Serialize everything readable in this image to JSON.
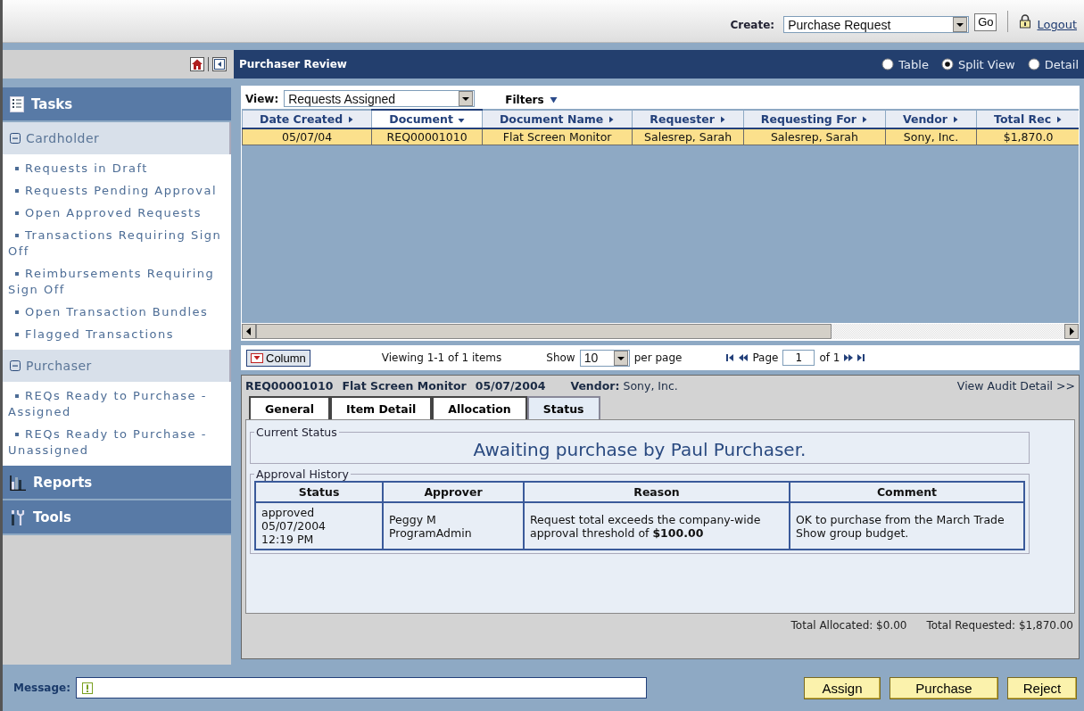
{
  "header": {
    "create_label": "Create:",
    "create_value": "Purchase Request",
    "go": "Go",
    "logout": "Logout"
  },
  "sidebar": {
    "sections": [
      {
        "title": "Tasks",
        "kind": "tasks",
        "groups": [
          {
            "title": "Cardholder",
            "expanded": true,
            "items": [
              "Requests in Draft",
              "Requests Pending Approval",
              "Open Approved Requests",
              "Transactions Requiring Sign Off",
              "Reimbursements Requiring Sign Off",
              "Open Transaction Bundles",
              "Flagged Transactions"
            ]
          },
          {
            "title": "Purchaser",
            "expanded": true,
            "items": [
              "REQs Ready to Purchase - Assigned",
              "REQs Ready to Purchase - Unassigned"
            ]
          }
        ]
      },
      {
        "title": "Reports",
        "kind": "reports"
      },
      {
        "title": "Tools",
        "kind": "tools"
      }
    ]
  },
  "main": {
    "title": "Purchaser Review",
    "view_modes": [
      {
        "label": "Table",
        "selected": false
      },
      {
        "label": "Split View",
        "selected": true
      },
      {
        "label": "Detail",
        "selected": false
      }
    ],
    "view_label": "View:",
    "view_value": "Requests Assigned",
    "filters": "Filters",
    "table": {
      "columns": [
        {
          "label": "Date Created",
          "sorted": false
        },
        {
          "label": "Document",
          "sorted": true
        },
        {
          "label": "Document Name",
          "sorted": false
        },
        {
          "label": "Requester",
          "sorted": false
        },
        {
          "label": "Requesting For",
          "sorted": false
        },
        {
          "label": "Vendor",
          "sorted": false
        },
        {
          "label": "Total Rec",
          "sorted": false
        }
      ],
      "rows": [
        {
          "selected": true,
          "cells": [
            "05/07/04",
            "REQ00001010",
            "Flat Screen Monitor",
            "Salesrep, Sarah",
            "Salesrep, Sarah",
            "Sony, Inc.",
            "$1,870.0"
          ]
        }
      ]
    },
    "column_button": "Column",
    "viewing": "Viewing 1-1 of 1 items",
    "show_label": "Show",
    "page_size": "10",
    "per_page": "per page",
    "page_label": "Page",
    "page": "1",
    "page_of": "of 1"
  },
  "detail": {
    "doc_id": "REQ00001010",
    "doc_name": "Flat Screen Monitor",
    "doc_date": "05/07/2004",
    "vendor_label": "Vendor:",
    "vendor": "Sony, Inc.",
    "audit_link": "View Audit Detail >>",
    "tabs": [
      {
        "label": "General",
        "selected": false
      },
      {
        "label": "Item Detail",
        "selected": false
      },
      {
        "label": "Allocation",
        "selected": false
      },
      {
        "label": "Status",
        "selected": true
      }
    ],
    "current_status_legend": "Current Status",
    "current_status": "Awaiting purchase by Paul Purchaser.",
    "history_legend": "Approval History",
    "history": {
      "columns": [
        "Status",
        "Approver",
        "Reason",
        "Comment"
      ],
      "rows": [
        [
          "approved\n05/07/2004\n12:19 PM",
          "Peggy M\nProgramAdmin",
          "Request total exceeds the company-wide approval threshold of **$100.00**",
          "OK to purchase from the March Trade Show group budget."
        ]
      ]
    },
    "total_allocated": "Total Allocated: $0.00",
    "total_requested": "Total Requested: $1,870.00"
  },
  "footer": {
    "message_label": "Message:",
    "buttons": [
      "Assign",
      "Purchase",
      "Reject"
    ]
  }
}
